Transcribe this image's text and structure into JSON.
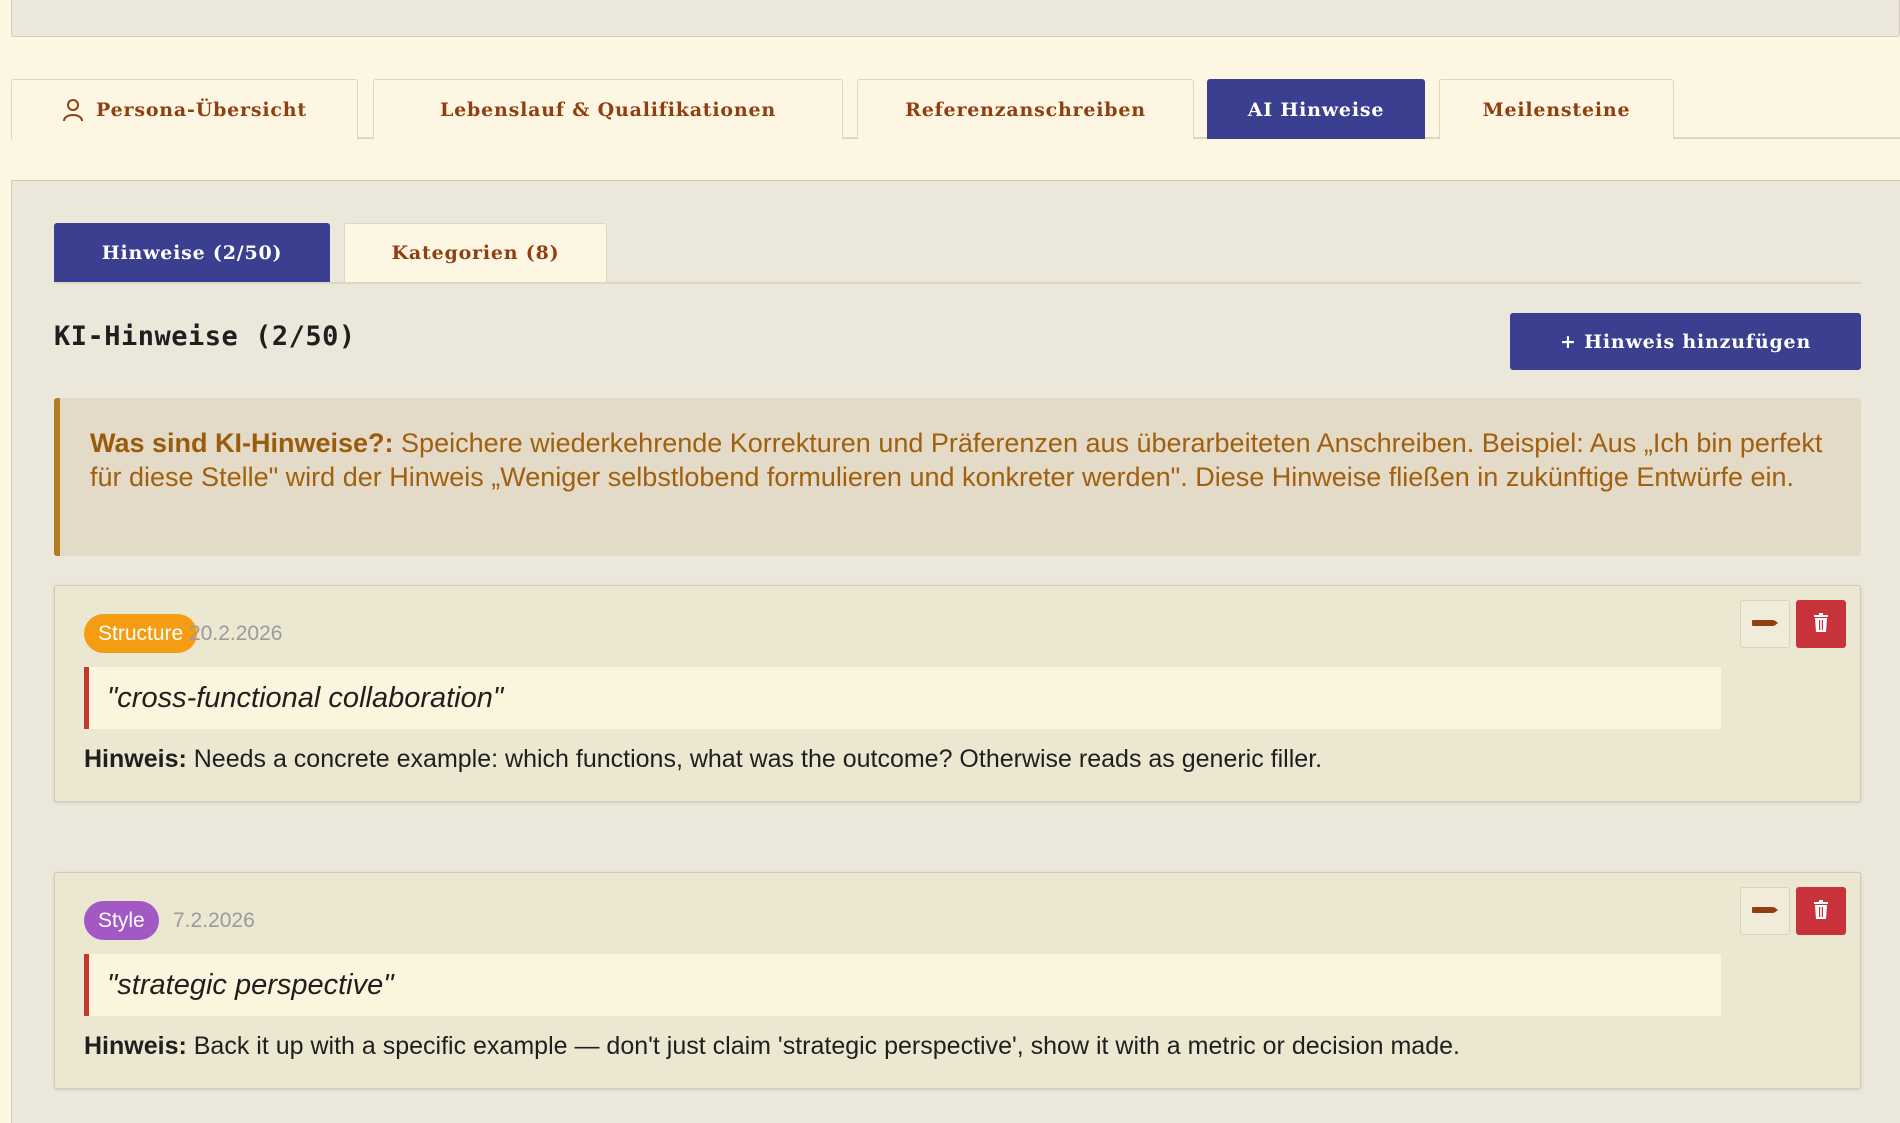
{
  "main_tabs": [
    {
      "label": "Persona-Übersicht",
      "icon": "person-icon",
      "active": false
    },
    {
      "label": "Lebenslauf & Qualifikationen",
      "active": false
    },
    {
      "label": "Referenzanschreiben",
      "active": false
    },
    {
      "label": "AI Hinweise",
      "active": true
    },
    {
      "label": "Meilensteine",
      "active": false
    }
  ],
  "sub_tabs": [
    {
      "label": "Hinweise (2/50)",
      "active": true
    },
    {
      "label": "Kategorien (8)",
      "active": false
    }
  ],
  "section": {
    "title": "KI-Hinweise (2/50)",
    "add_button_label": "+ Hinweis hinzufügen"
  },
  "info": {
    "heading": "Was sind KI-Hinweise?:",
    "text": " Speichere wiederkehrende Korrekturen und Präferenzen aus überarbeiteten Anschreiben. Beispiel: Aus „Ich bin perfekt für diese Stelle\" wird der Hinweis „Weniger selbstlobend formulieren und konkreter werden\". Diese Hinweise fließen in zukünftige Entwürfe ein."
  },
  "note_label": "Hinweis:",
  "hints": [
    {
      "category": "Structure",
      "category_color": "#f49d12",
      "date": "20.2.2026",
      "quote": "\"cross-functional collaboration\"",
      "note": " Needs a concrete example: which functions, what was the outcome? Otherwise reads as generic filler."
    },
    {
      "category": "Style",
      "category_color": "#a259c4",
      "date": "7.2.2026",
      "quote": "\"strategic perspective\"",
      "note": " Back it up with a specific example — don't just claim 'strategic perspective', show it with a metric or decision made."
    }
  ],
  "colors": {
    "accent": "#3a3f8f",
    "tab_text": "#8f3f12",
    "delete": "#c8323a",
    "info_border": "#b07d1f"
  }
}
